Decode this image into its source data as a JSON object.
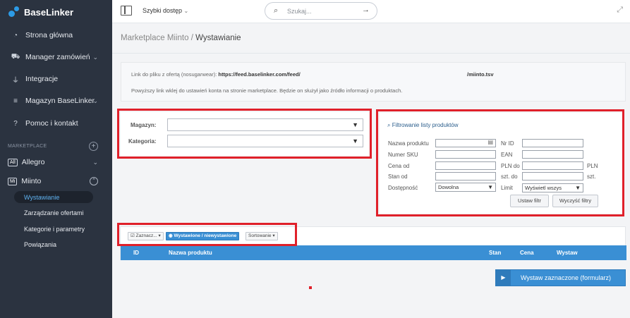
{
  "app": {
    "name": "BaseLinker"
  },
  "sidebar": {
    "items": [
      {
        "label": "Strona główna",
        "icon": "dashboard-icon",
        "glyph": "◔"
      },
      {
        "label": "Manager zamówień",
        "icon": "cart-icon",
        "glyph": "🛒",
        "chevron": "⌄"
      },
      {
        "label": "Integracje",
        "icon": "plug-icon",
        "glyph": "⏚"
      },
      {
        "label": "Magazyn BaseLinker",
        "icon": "database-icon",
        "glyph": "≡",
        "chevron": "⌄"
      },
      {
        "label": "Pomoc i kontakt",
        "icon": "help-icon",
        "glyph": "?"
      }
    ],
    "section_label": "MARKETPLACE",
    "marketplaces": [
      {
        "badge": "All",
        "label": "Allegro",
        "chevron": "⌄"
      },
      {
        "badge": "Mi",
        "label": "Miinto",
        "chevron": "⌃"
      }
    ],
    "subitems": [
      {
        "label": "Wystawianie",
        "active": true
      },
      {
        "label": "Zarządzanie ofertami"
      },
      {
        "label": "Kategorie i parametry"
      },
      {
        "label": "Powiązania"
      }
    ]
  },
  "topbar": {
    "quick_access": "Szybki dostęp",
    "search_placeholder": "Szukaj..."
  },
  "breadcrumb": {
    "parent": "Marketplace Miinto",
    "separator": " / ",
    "current": "Wystawianie"
  },
  "info": {
    "line1_prefix": "Link do pliku z ofertą (nosugarwear): ",
    "line1_url": "https://feed.baselinker.com/feed/",
    "line1_suffix": "/miinto.tsv",
    "line2": "Powyższy link wklej do ustawień konta na stronie marketplace. Będzie on służył jako źródło informacji o produktach."
  },
  "warehouse": {
    "magazyn_label": "Magazyn:",
    "kategoria_label": "Kategoria:"
  },
  "filters": {
    "title": "Filtrowanie listy produktów",
    "nazwa": "Nazwa produktu",
    "nr_id": "Nr ID",
    "sku": "Numer SKU",
    "ean": "EAN",
    "cena_od": "Cena od",
    "pln_do": "PLN do",
    "pln": "PLN",
    "stan_od": "Stan od",
    "szt_do": "szt. do",
    "szt": "szt.",
    "dostepnosc": "Dostępność",
    "dostepnosc_value": "Dowolna",
    "limit": "Limit",
    "limit_value": "Wyświetl wszys",
    "apply": "Ustaw filtr",
    "clear": "Wyczyść filtry"
  },
  "table": {
    "select_label": "Zaznacz...",
    "listed_label": "Wystawione / niewystawione",
    "sort_label": "Sortowanie",
    "columns": {
      "id": "ID",
      "name": "Nazwa produktu",
      "stock": "Stan",
      "price": "Cena",
      "list": "Wystaw"
    }
  },
  "submit_label": "Wystaw zaznaczone (formularz)",
  "colors": {
    "sidebar": "#2b3340",
    "accent": "#3a8fd4",
    "highlight": "#e0202a"
  }
}
